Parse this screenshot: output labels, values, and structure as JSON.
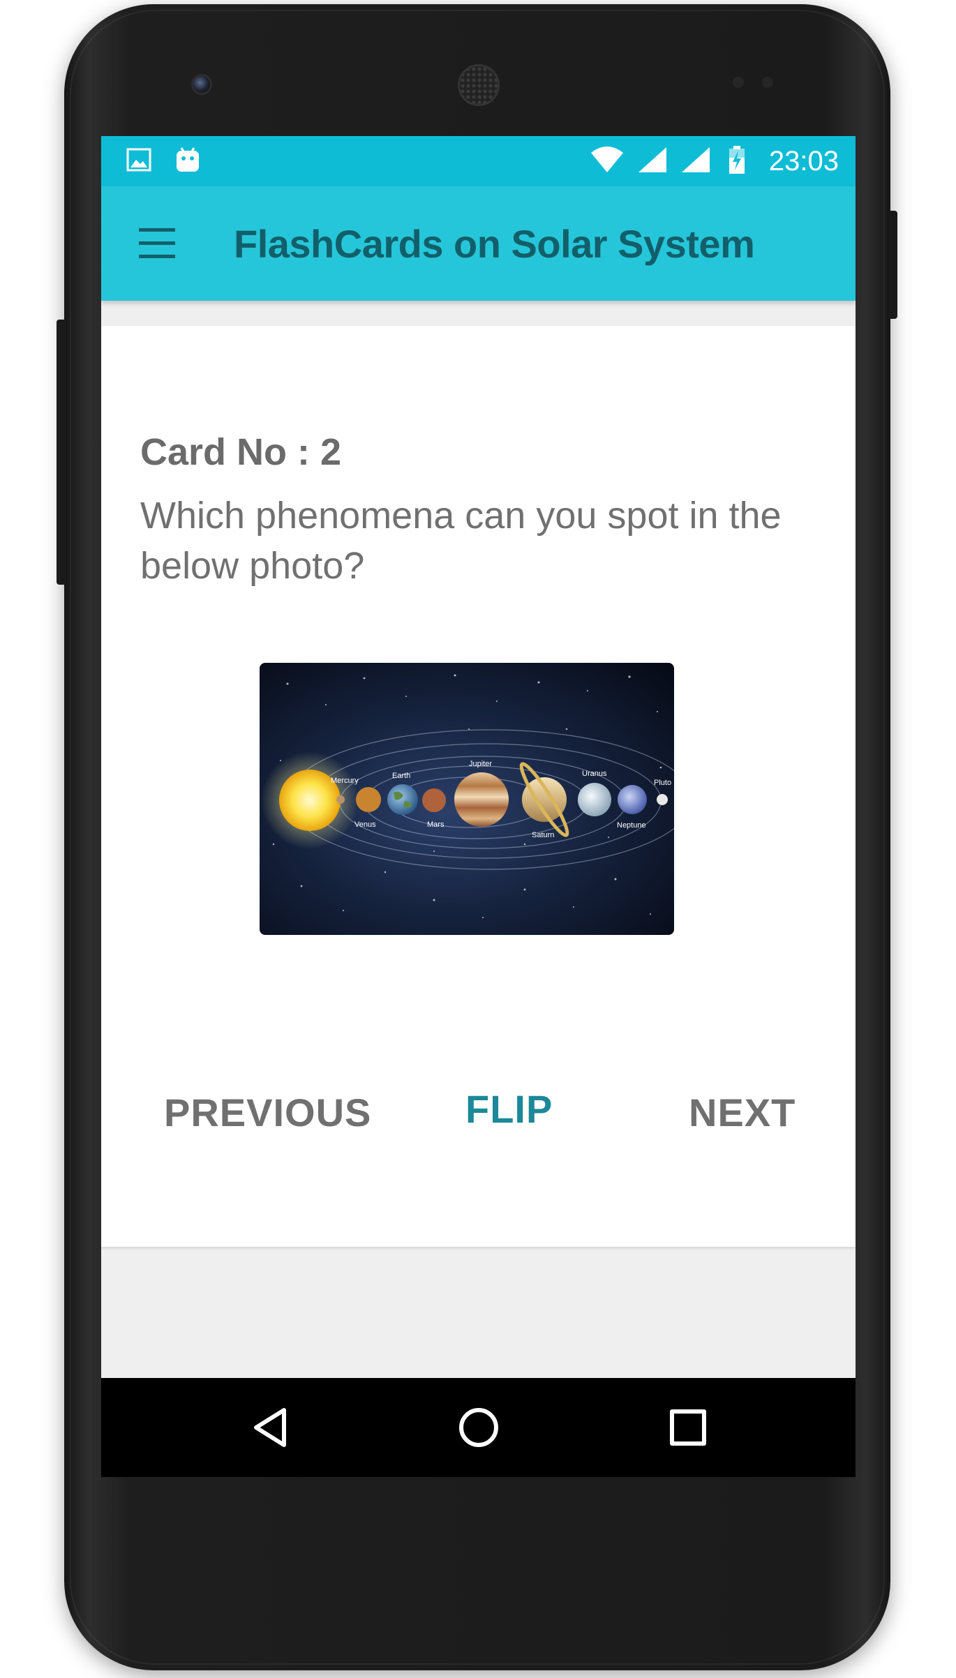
{
  "status_bar": {
    "time": "23:03",
    "left_icons": [
      "image-icon",
      "android-icon"
    ],
    "right_icons": [
      "wifi-icon",
      "signal-icon",
      "signal-icon",
      "battery-icon"
    ]
  },
  "app_bar": {
    "title": "FlashCards on Solar System",
    "menu_icon": "menu-icon"
  },
  "card": {
    "number_label": "Card No : 2",
    "question": "Which phenomena can you spot in the below photo?",
    "image_labels": {
      "mercury": "Mercury",
      "venus": "Venus",
      "earth": "Earth",
      "mars": "Mars",
      "jupiter": "Jupiter",
      "saturn": "Saturn",
      "uranus": "Uranus",
      "neptune": "Neptune",
      "pluto": "Pluto"
    }
  },
  "actions": {
    "previous": "PREVIOUS",
    "flip": "FLIP",
    "next": "NEXT"
  },
  "nav_bar": {
    "back_icon": "back-icon",
    "home_icon": "home-icon",
    "recents_icon": "recents-icon"
  },
  "colors": {
    "status_bar": "#0fbcd6",
    "app_bar": "#26c6da",
    "title_text": "#125f6a",
    "flip_accent": "#1c8898",
    "button_text": "#707070"
  }
}
